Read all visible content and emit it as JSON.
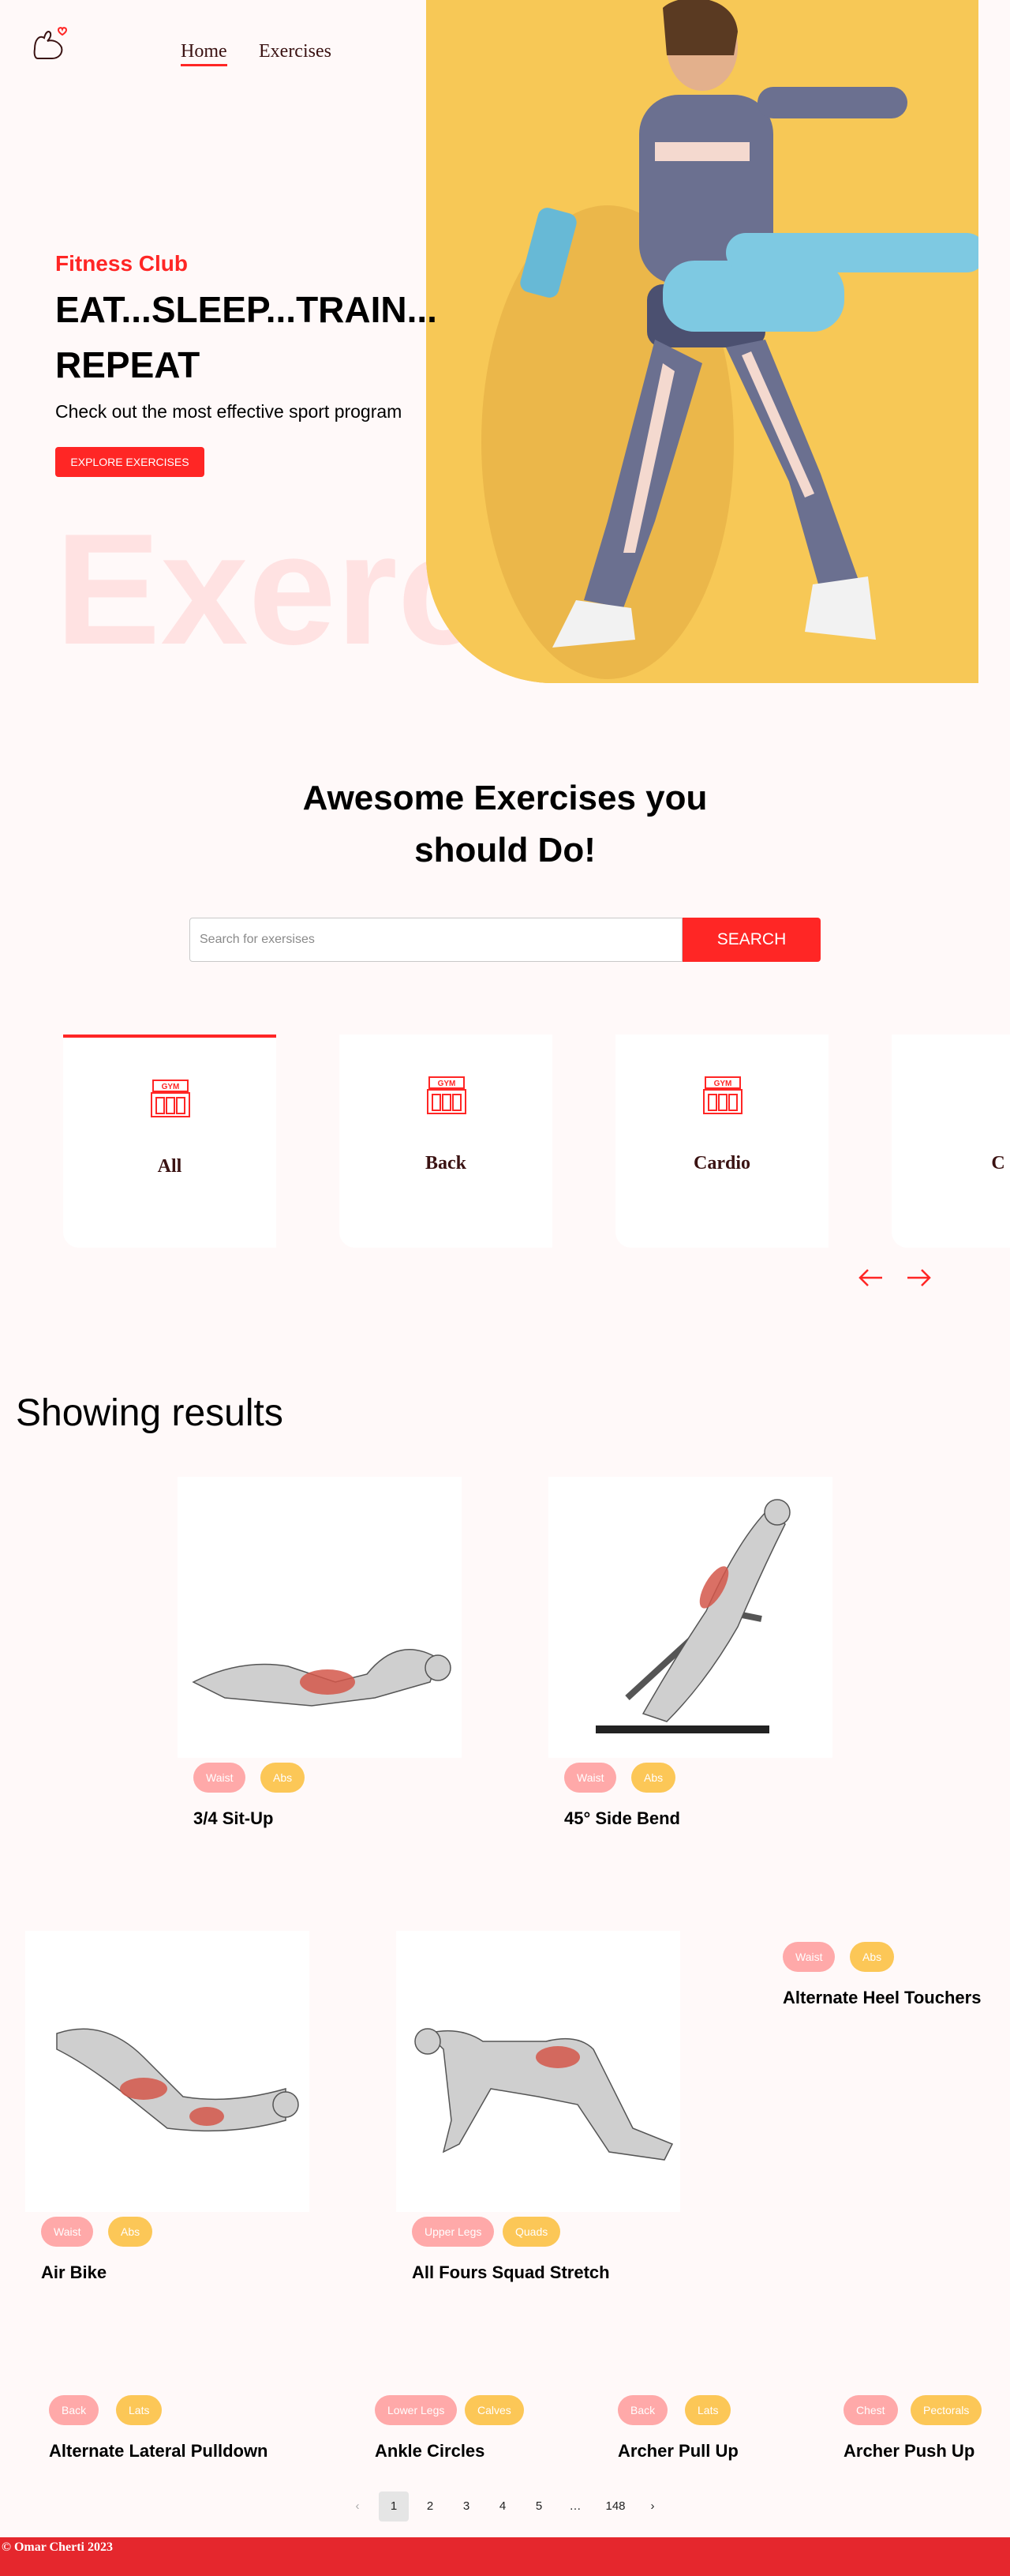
{
  "nav": {
    "home": "Home",
    "exercises": "Exercises"
  },
  "hero": {
    "subtitle": "Fitness Club",
    "title_line1": "EAT...SLEEP...TRAIN...",
    "title_line2": "REPEAT",
    "description": "Check out the most effective sport program",
    "button": "EXPLORE EXERCISES",
    "watermark": "Exercises"
  },
  "search": {
    "heading_line1": "Awesome Exercises you",
    "heading_line2": "should Do!",
    "placeholder": "Search for exersises",
    "button": "SEARCH"
  },
  "categories": [
    {
      "label": "All",
      "icon": "gym-icon",
      "active": true
    },
    {
      "label": "Back",
      "icon": "gym-icon"
    },
    {
      "label": "Cardio",
      "icon": "gym-icon"
    },
    {
      "label": "C",
      "icon": "gym-icon"
    }
  ],
  "results": {
    "title": "Showing results",
    "items": [
      {
        "name": "3/4 Sit-Up",
        "tags": [
          "Waist",
          "Abs"
        ]
      },
      {
        "name": "45° Side Bend",
        "tags": [
          "Waist",
          "Abs"
        ]
      },
      {
        "name": "Air Bike",
        "tags": [
          "Waist",
          "Abs"
        ]
      },
      {
        "name": "All Fours Squad Stretch",
        "tags": [
          "Upper Legs",
          "Quads"
        ]
      },
      {
        "name": "Alternate Heel Touchers",
        "tags": [
          "Waist",
          "Abs"
        ]
      },
      {
        "name": "Alternate Lateral Pulldown",
        "tags": [
          "Back",
          "Lats"
        ]
      },
      {
        "name": "Ankle Circles",
        "tags": [
          "Lower Legs",
          "Calves"
        ]
      },
      {
        "name": "Archer Pull Up",
        "tags": [
          "Back",
          "Lats"
        ]
      },
      {
        "name": "Archer Push Up",
        "tags": [
          "Chest",
          "Pectorals"
        ]
      }
    ]
  },
  "pagination": {
    "prev": "‹",
    "pages": [
      "1",
      "2",
      "3",
      "4",
      "5"
    ],
    "ellipsis": "…",
    "last": "148",
    "next": "›",
    "current": "1"
  },
  "footer": {
    "text": "© Omar Cherti 2023"
  },
  "colors": {
    "accent": "#ff2625",
    "tag_pink": "#ffa9a9",
    "tag_yellow": "#fcc757",
    "hero_bg": "#f7c856",
    "footer": "#e5272d"
  }
}
